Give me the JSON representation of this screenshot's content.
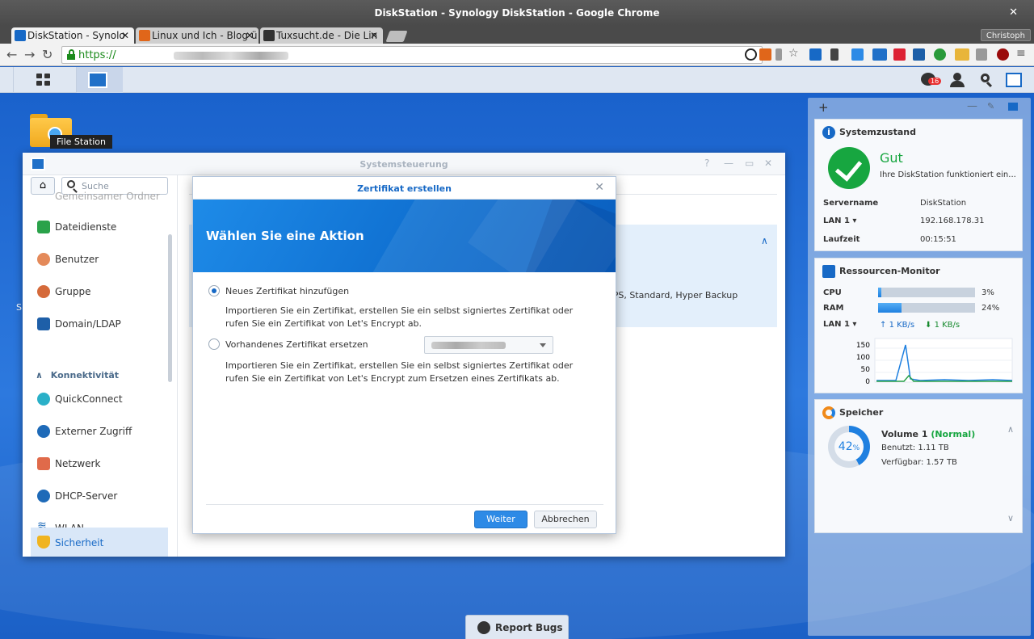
{
  "browser": {
    "window_title": "DiskStation - Synology DiskStation - Google Chrome",
    "tabs": [
      {
        "label": "DiskStation - Synolo"
      },
      {
        "label": "Linux und Ich - Blog ü"
      },
      {
        "label": "Tuxsucht.de - Die Lin"
      }
    ],
    "profile": "Christoph",
    "url_prefix": "https://",
    "colors": {
      "secure": "#1a8a1a"
    }
  },
  "dsm": {
    "notification_count": "16",
    "report_bugs": "Report Bugs"
  },
  "desktop": {
    "file_station_label": "File Station",
    "clipped_letter": "S"
  },
  "control_panel": {
    "title": "Systemsteuerung",
    "search_placeholder": "Suche",
    "cut_item": "Gemeinsamer Ordner",
    "items_top": [
      {
        "label": "Dateidienste",
        "icon": "file-services-icon"
      },
      {
        "label": "Benutzer",
        "icon": "user-icon"
      },
      {
        "label": "Gruppe",
        "icon": "group-icon"
      },
      {
        "label": "Domain/LDAP",
        "icon": "domain-icon"
      }
    ],
    "section": "Konnektivität",
    "items_conn": [
      {
        "label": "QuickConnect",
        "icon": "quickconnect-icon"
      },
      {
        "label": "Externer Zugriff",
        "icon": "external-access-icon"
      },
      {
        "label": "Netzwerk",
        "icon": "network-icon"
      },
      {
        "label": "DHCP-Server",
        "icon": "dhcp-icon"
      },
      {
        "label": "WLAN",
        "icon": "wifi-icon"
      },
      {
        "label": "Sicherheit",
        "icon": "security-icon"
      }
    ],
    "main_fragment": "TPS, Standard, Hyper Backup"
  },
  "dialog": {
    "title": "Zertifikat erstellen",
    "heading": "Wählen Sie eine Aktion",
    "option1_label": "Neues Zertifikat hinzufügen",
    "option1_desc": "Importieren Sie ein Zertifikat, erstellen Sie ein selbst signiertes Zertifikat oder rufen Sie ein Zertifikat von Let's Encrypt ab.",
    "option2_label": "Vorhandenes Zertifikat ersetzen",
    "option2_desc": "Importieren Sie ein Zertifikat, erstellen Sie ein selbst signiertes Zertifikat oder rufen Sie ein Zertifikat von Let's Encrypt zum Ersetzen eines Zertifikats ab.",
    "selected_option": 1,
    "btn_next": "Weiter",
    "btn_cancel": "Abbrechen"
  },
  "widgets": {
    "system": {
      "title": "Systemzustand",
      "status": "Gut",
      "status_desc": "Ihre DiskStation funktioniert ein...",
      "rows": [
        {
          "k": "Servername",
          "v": "DiskStation"
        },
        {
          "k": "LAN 1 ▾",
          "v": "192.168.178.31"
        },
        {
          "k": "Laufzeit",
          "v": "00:15:51"
        }
      ]
    },
    "resources": {
      "title": "Ressourcen-Monitor",
      "cpu_label": "CPU",
      "cpu_pct": "3%",
      "cpu": 0.03,
      "ram_label": "RAM",
      "ram_pct": "24%",
      "ram": 0.24,
      "lan_label": "LAN 1 ▾",
      "up": "1 KB/s",
      "down": "1 KB/s",
      "y_ticks": [
        "150",
        "100",
        "50",
        "0"
      ]
    },
    "storage": {
      "title": "Speicher",
      "percent": "42",
      "percent_unit": "%",
      "fraction": 0.42,
      "volume": "Volume 1",
      "volume_status": "(Normal)",
      "used": "Benutzt: 1.11 TB",
      "free": "Verfügbar: 1.57 TB"
    }
  }
}
